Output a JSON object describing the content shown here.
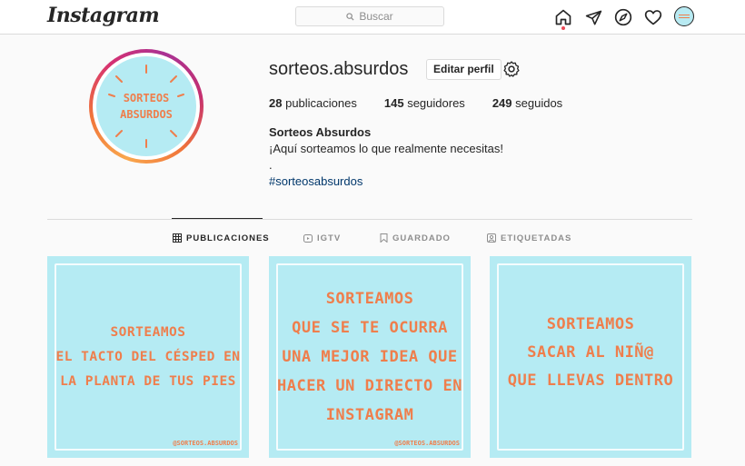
{
  "topbar": {
    "logo": "Instagram",
    "search_placeholder": "Buscar",
    "icons": [
      "home-icon",
      "direct-icon",
      "explore-icon",
      "activity-icon",
      "avatar"
    ]
  },
  "profile": {
    "avatar_text_1": "SORTEOS",
    "avatar_text_2": "ABSURDOS",
    "username": "sorteos.absurdos",
    "edit_label": "Editar perfil",
    "stats": [
      {
        "count": "28",
        "label": "publicaciones"
      },
      {
        "count": "145",
        "label": "seguidores"
      },
      {
        "count": "249",
        "label": "seguidos"
      }
    ],
    "bio_name": "Sorteos Absurdos",
    "bio_line": "¡Aquí sorteamos lo que realmente necesitas!",
    "bio_dot": ".",
    "bio_tag": "#sorteosabsurdos"
  },
  "tabs": [
    {
      "label": "PUBLICACIONES",
      "icon": "grid-icon",
      "active": true
    },
    {
      "label": "IGTV",
      "icon": "igtv-icon"
    },
    {
      "label": "GUARDADO",
      "icon": "bookmark-icon"
    },
    {
      "label": "ETIQUETADAS",
      "icon": "tagged-icon"
    }
  ],
  "posts": [
    {
      "text": "SORTEAMOS\nEL TACTO DEL CÉSPED EN\nLA PLANTA DE TUS PIES",
      "handle": "@SORTEOS.ABSURDOS"
    },
    {
      "text": "SORTEAMOS\nQUE SE TE OCURRA\nUNA MEJOR IDEA QUE\nHACER UN DIRECTO EN\nINSTAGRAM",
      "handle": "@SORTEOS.ABSURDOS"
    },
    {
      "text": "SORTEAMOS\nSACAR AL NIÑ@\nQUE LLEVAS DENTRO",
      "handle": ""
    }
  ],
  "colors": {
    "post_bg": "#b5ebf3",
    "post_text": "#ef7e4c",
    "link": "#00376b",
    "notification": "#ed4956"
  }
}
